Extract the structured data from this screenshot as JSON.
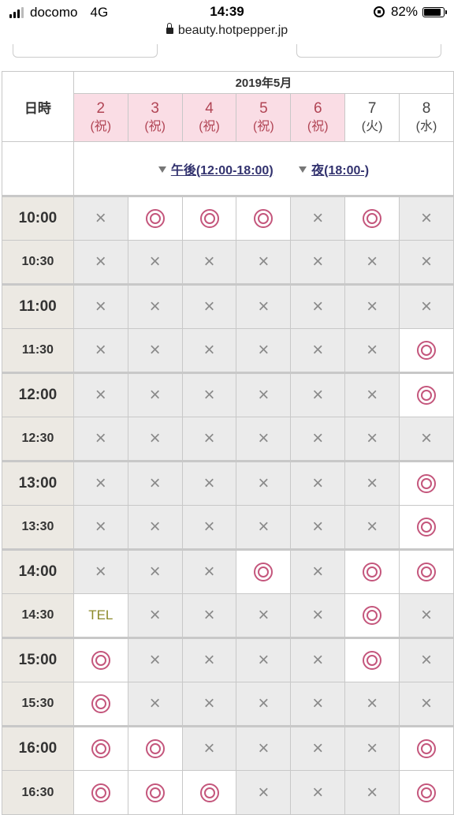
{
  "status_bar": {
    "carrier": "docomo",
    "network": "4G",
    "time": "14:39",
    "battery": "82%"
  },
  "browser": {
    "url": "beauty.hotpepper.jp"
  },
  "calendar": {
    "corner_label": "日時",
    "month": "2019年5月",
    "days": [
      {
        "date": "2",
        "dow": "(祝)",
        "holiday": true
      },
      {
        "date": "3",
        "dow": "(祝)",
        "holiday": true
      },
      {
        "date": "4",
        "dow": "(祝)",
        "holiday": true
      },
      {
        "date": "5",
        "dow": "(祝)",
        "holiday": true
      },
      {
        "date": "6",
        "dow": "(祝)",
        "holiday": true
      },
      {
        "date": "7",
        "dow": "(火)",
        "holiday": false
      },
      {
        "date": "8",
        "dow": "(水)",
        "holiday": false
      }
    ],
    "filters": [
      {
        "label": "午後(12:00-18:00)"
      },
      {
        "label": "夜(18:00-)"
      }
    ],
    "slot_symbols": {
      "available": "◎",
      "full": "×",
      "tel": "TEL"
    },
    "rows": [
      {
        "time": "10:00",
        "slots": [
          "x",
          "o",
          "o",
          "o",
          "x",
          "o",
          "x"
        ]
      },
      {
        "time": "10:30",
        "slots": [
          "x",
          "x",
          "x",
          "x",
          "x",
          "x",
          "x"
        ]
      },
      {
        "time": "11:00",
        "slots": [
          "x",
          "x",
          "x",
          "x",
          "x",
          "x",
          "x"
        ]
      },
      {
        "time": "11:30",
        "slots": [
          "x",
          "x",
          "x",
          "x",
          "x",
          "x",
          "o"
        ]
      },
      {
        "time": "12:00",
        "slots": [
          "x",
          "x",
          "x",
          "x",
          "x",
          "x",
          "o"
        ]
      },
      {
        "time": "12:30",
        "slots": [
          "x",
          "x",
          "x",
          "x",
          "x",
          "x",
          "x"
        ]
      },
      {
        "time": "13:00",
        "slots": [
          "x",
          "x",
          "x",
          "x",
          "x",
          "x",
          "o"
        ]
      },
      {
        "time": "13:30",
        "slots": [
          "x",
          "x",
          "x",
          "x",
          "x",
          "x",
          "o"
        ]
      },
      {
        "time": "14:00",
        "slots": [
          "x",
          "x",
          "x",
          "o",
          "x",
          "o",
          "o"
        ]
      },
      {
        "time": "14:30",
        "slots": [
          "tel",
          "x",
          "x",
          "x",
          "x",
          "o",
          "x"
        ]
      },
      {
        "time": "15:00",
        "slots": [
          "o",
          "x",
          "x",
          "x",
          "x",
          "o",
          "x"
        ]
      },
      {
        "time": "15:30",
        "slots": [
          "o",
          "x",
          "x",
          "x",
          "x",
          "x",
          "x"
        ]
      },
      {
        "time": "16:00",
        "slots": [
          "o",
          "o",
          "x",
          "x",
          "x",
          "x",
          "o"
        ]
      },
      {
        "time": "16:30",
        "slots": [
          "o",
          "o",
          "o",
          "x",
          "x",
          "x",
          "o"
        ]
      }
    ]
  }
}
